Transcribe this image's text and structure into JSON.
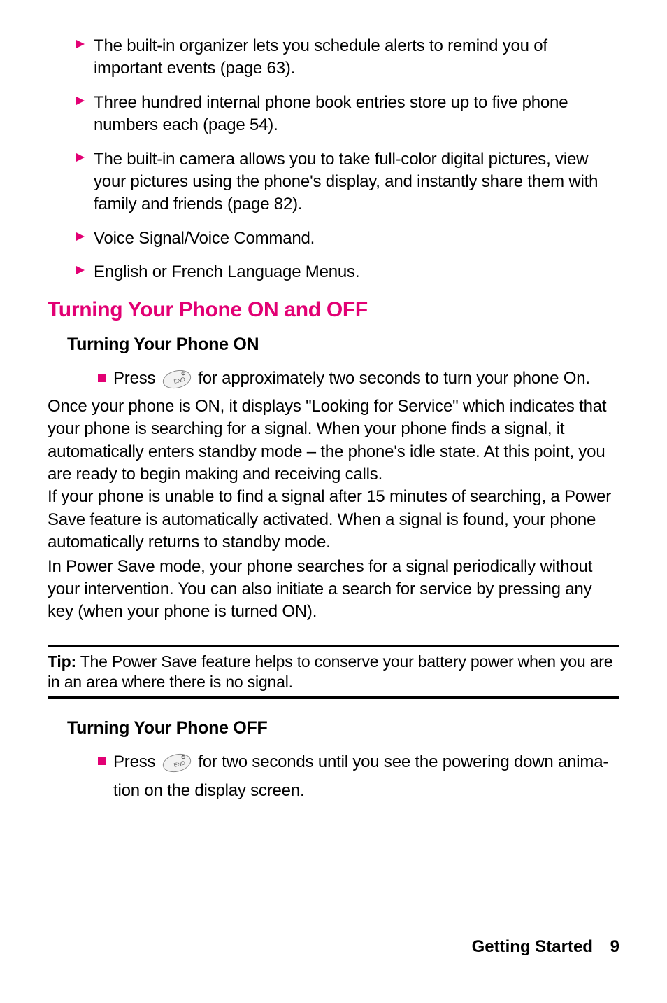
{
  "bullets_top": [
    {
      "text": "The built-in organizer lets you schedule alerts to remind you of important events (page 63)."
    },
    {
      "text": "Three hundred internal phone book entries store up to five phone numbers each (page 54)."
    },
    {
      "text": "The built-in camera allows you to take full-color digital pictures, view your pictures using the phone's display, and instantly share them with family and friends (page 82)."
    },
    {
      "text": "Voice Signal/Voice Command."
    },
    {
      "text": "English or French Language Menus."
    }
  ],
  "section_title": "Turning Your Phone ON and OFF",
  "sub_on": "Turning Your Phone ON",
  "press_label": "Press",
  "on_text_after": " for approximately two seconds to turn your phone On.",
  "on_para1": "Once your phone is ON, it displays \"Looking for Service\" which indicates that your phone is searching for a signal. When your phone finds a signal, it automatically enters standby mode – the phone's idle state. At this point, you are ready to begin making and receiving calls.",
  "on_para2": "If your phone is unable to find a signal after 15 minutes of searching, a Power Save feature is automatically activated. When a signal is found, your phone automatically returns to standby mode.",
  "on_para3": "In Power Save mode, your phone searches for a signal periodically without your intervention. You can also initiate a search for service by pressing any key (when your phone is turned ON).",
  "tip_label": "Tip:",
  "tip_text": " The Power Save feature helps to conserve your battery power when you are in an area where there is no signal.",
  "sub_off": "Turning Your Phone OFF",
  "off_text_after": " for two seconds until you see the powering down anima",
  "off_line2": "tion on the display screen.",
  "footer_chapter": "Getting Started",
  "footer_page": "9",
  "colors": {
    "accent": "#e20074"
  }
}
